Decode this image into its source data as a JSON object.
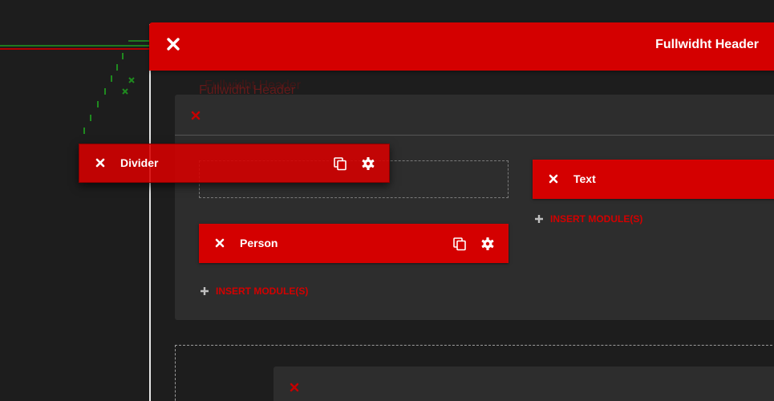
{
  "fullwidth_header": {
    "title": "Fullwidht Header",
    "ghost_title": "Fullwidht Header"
  },
  "row": {
    "left_column": {
      "modules": [
        {
          "label": "Person"
        }
      ],
      "insert_label": "INSERT MODULE(S)"
    },
    "right_column": {
      "modules": [
        {
          "label": "Text"
        }
      ],
      "insert_label": "INSERT MODULE(S)"
    }
  },
  "dragging_module": {
    "label": "Divider"
  },
  "icons": {
    "close": "close-icon",
    "copy": "copy-icon",
    "settings": "gear-icon",
    "add": "plus-icon"
  },
  "colors": {
    "accent": "#d40000",
    "background": "#1d1d1d",
    "panel": "#2d2d2d",
    "text": "#ffffff"
  }
}
